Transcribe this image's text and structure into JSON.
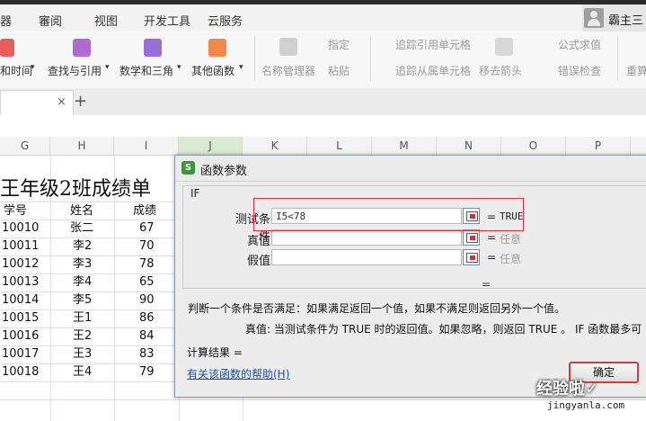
{
  "menu": {
    "items": [
      {
        "label": "審阅"
      },
      {
        "label": "视图"
      },
      {
        "label": "开发工具"
      },
      {
        "label": "云服务"
      }
    ],
    "partial_left": "器",
    "username": "霸主三"
  },
  "ribbon": {
    "date_time": "和时间",
    "lookup_ref": "查找与引用",
    "math_trig": "数学和三角",
    "other_funcs": "其他函数",
    "name_manager": "名称管理器",
    "specify": "指定",
    "paste": "粘贴",
    "trace_precedents": "追踪引用单元格",
    "trace_dependents": "追踪从属单元格",
    "remove_arrows": "移去箭头",
    "formula_eval": "公式求值",
    "error_check": "错误检查",
    "recalc": "重算"
  },
  "tabs": {
    "close": "×",
    "add": "+"
  },
  "columns": [
    "G",
    "H",
    "I",
    "J",
    "K",
    "L",
    "M",
    "N",
    "O",
    "P"
  ],
  "sheet": {
    "title": "王年级2班成绩单",
    "headers": {
      "id": "学号",
      "name": "姓名",
      "score": "成绩"
    },
    "rows": [
      {
        "id": "10010",
        "name": "张二",
        "score": "67"
      },
      {
        "id": "10011",
        "name": "李2",
        "score": "70"
      },
      {
        "id": "10012",
        "name": "李3",
        "score": "78"
      },
      {
        "id": "10013",
        "name": "李4",
        "score": "65"
      },
      {
        "id": "10014",
        "name": "李5",
        "score": "90"
      },
      {
        "id": "10015",
        "name": "王1",
        "score": "86"
      },
      {
        "id": "10016",
        "name": "王2",
        "score": "84"
      },
      {
        "id": "10017",
        "name": "王3",
        "score": "83"
      },
      {
        "id": "10018",
        "name": "王4",
        "score": "79"
      }
    ]
  },
  "dialog": {
    "title": "函数参数",
    "icon_letter": "S",
    "function_name": "IF",
    "args": [
      {
        "label": "测试条件",
        "value": "I5<78",
        "result": "TRUE"
      },
      {
        "label": "真值",
        "value": "",
        "result": "任意"
      },
      {
        "label": "假值",
        "value": "",
        "result": "任意"
      }
    ],
    "equals": "=",
    "description": "判断一个条件是否满足：如果满足返回一个值，如果不满足则返回另外一个值。",
    "arg_description": "真值:  当测试条件为 TRUE 时的返回值。如果忽略，则返回 TRUE 。 IF 函数最多可",
    "calc_result_label": "计算结果 =",
    "help_link": "有关该函数的帮助(H)",
    "ok_label": "确定"
  },
  "watermark": {
    "text": "经验啦✓",
    "sub": "jingyanla.com"
  },
  "colors": {
    "highlight": "#e03030",
    "link": "#1a4fb0",
    "dialog_icon": "#3a9a3a"
  }
}
